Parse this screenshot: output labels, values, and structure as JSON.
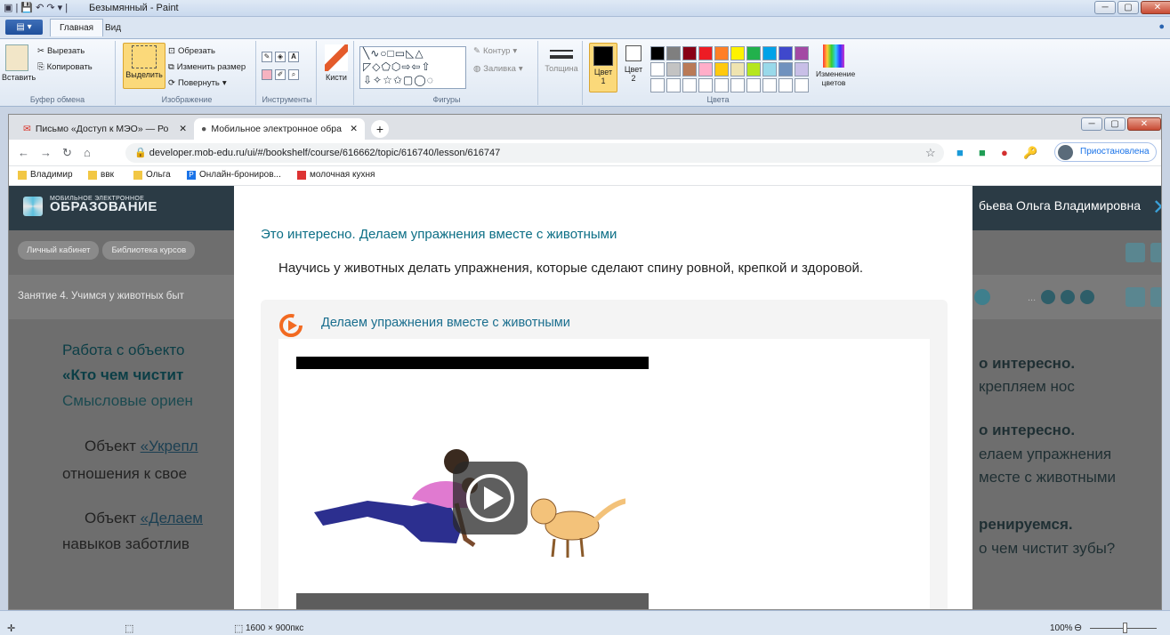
{
  "paint": {
    "title": "Безымянный - Paint",
    "tabs": {
      "main": "Главная",
      "view": "Вид"
    },
    "clipboard": {
      "paste": "Вставить",
      "cut": "Вырезать",
      "copy": "Копировать",
      "group": "Буфер обмена"
    },
    "image": {
      "select": "Выделить",
      "crop": "Обрезать",
      "resize": "Изменить размер",
      "rotate": "Повернуть",
      "group": "Изображение"
    },
    "tools": {
      "group": "Инструменты"
    },
    "brushes": "Кисти",
    "shapes": {
      "outline": "Контур",
      "fill": "Заливка",
      "group": "Фигуры"
    },
    "thickness": "Толщина",
    "color1": {
      "a": "Цвет",
      "b": "1"
    },
    "color2": {
      "a": "Цвет",
      "b": "2"
    },
    "edit_colors": "Изменение цветов",
    "colors_group": "Цвета",
    "palette_row1": [
      "#000000",
      "#7f7f7f",
      "#880015",
      "#ed1c24",
      "#ff7f27",
      "#fff200",
      "#22b14c",
      "#00a2e8",
      "#3f48cc",
      "#a349a4"
    ],
    "palette_row2": [
      "#ffffff",
      "#c3c3c3",
      "#b97a57",
      "#ffaec9",
      "#ffc90e",
      "#efe4b0",
      "#b5e61d",
      "#99d9ea",
      "#7092be",
      "#c8bfe7"
    ],
    "status": {
      "size": "1600 × 900пкс",
      "zoom": "100%"
    }
  },
  "chrome": {
    "tabs": [
      {
        "label": "Письмо «Доступ к МЭО» — Ро"
      },
      {
        "label": "Мобильное электронное обра"
      }
    ],
    "url": "developer.mob-edu.ru/ui/#/bookshelf/course/616662/topic/616740/lesson/616747",
    "profile": "Приостановлена",
    "bookmarks": [
      "Владимир",
      "ввк",
      "Ольга",
      "Онлайн-брониров...",
      "молочная кухня"
    ]
  },
  "site": {
    "logo_small": "МОБИЛЬНОЕ ЭЛЕКТРОННОЕ",
    "logo_big": "ОБРАЗОВАНИЕ",
    "user": "бьева Ольга Владимировна",
    "crumbs": [
      "Личный кабинет",
      "Библиотека курсов"
    ],
    "lesson": "Занятие 4. Учимся у животных быт",
    "bg_left": {
      "h1": "Работа с объекто",
      "h2": "«Кто чем чистит",
      "h3": "Смысловые ориен",
      "p1a": "Объект ",
      "p1link": "«Укрепл",
      "p1b": "отношения к свое",
      "p2a": "Объект ",
      "p2link": "«Делаем",
      "p2b": "навыков заботлив"
    },
    "bg_right": {
      "a1": "о интересно.",
      "a2": "крепляем нос",
      "b1": "о интересно.",
      "b2": "елаем упражнения",
      "b3": "месте с животными",
      "c1": "ренируемся.",
      "c2": "о чем чистит зубы?"
    }
  },
  "modal": {
    "title": "Это интересно. Делаем упражнения вместе с животными",
    "subtitle": "Научись у животных делать упражнения, которые сделают спину ровной, крепкой и здоровой.",
    "card_title": "Делаем упражнения вместе с животными"
  }
}
